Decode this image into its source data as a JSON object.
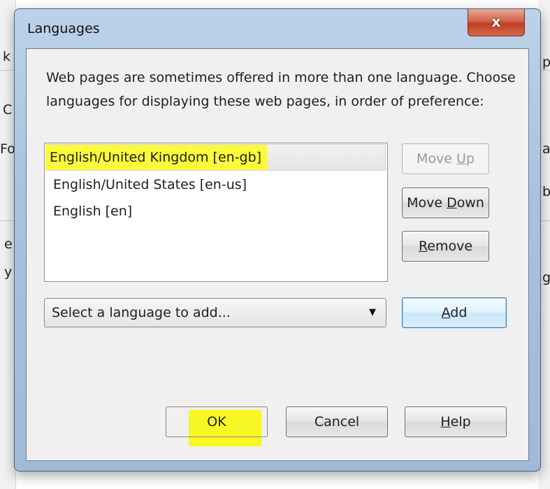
{
  "background_window": {
    "left_chars": [
      "k",
      "C",
      "Fo",
      "e",
      "y"
    ],
    "right_chars": [
      "p",
      "a",
      "b",
      "g"
    ]
  },
  "dialog": {
    "title": "Languages",
    "close_glyph": "x",
    "description": "Web pages are sometimes offered in more than one language. Choose languages for displaying these web pages, in order of preference:",
    "languages": [
      "English/United Kingdom  [en-gb]",
      "English/United States  [en-us]",
      "English  [en]"
    ],
    "selected_index": 0,
    "buttons": {
      "move_up": {
        "prefix": "Move ",
        "key": "U",
        "suffix": "p"
      },
      "move_down": {
        "prefix": "Move ",
        "key": "D",
        "suffix": "own"
      },
      "remove": {
        "prefix": "",
        "key": "R",
        "suffix": "emove"
      },
      "add": {
        "prefix": "",
        "key": "A",
        "suffix": "dd"
      },
      "ok": "OK",
      "cancel": "Cancel",
      "help": {
        "prefix": "",
        "key": "H",
        "suffix": "elp"
      }
    },
    "add_language_select": {
      "value": "Select a language to add..."
    }
  },
  "colors": {
    "highlight": "#fafa3a",
    "close_button": "#c94a2e",
    "title_bar": "#b2c9e3"
  }
}
